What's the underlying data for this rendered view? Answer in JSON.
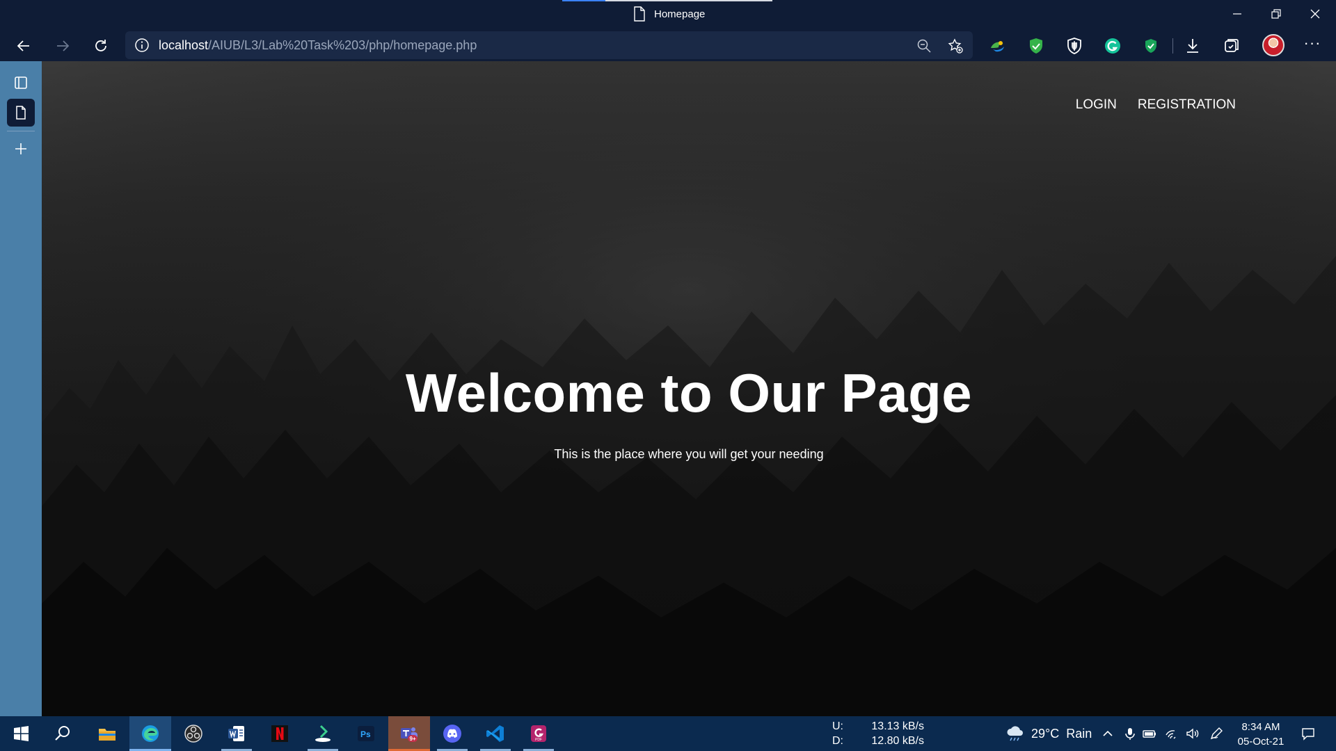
{
  "window": {
    "title": "Homepage"
  },
  "browser": {
    "url_host": "localhost",
    "url_path": "/AIUB/L3/Lab%20Task%203/php/homepage.php"
  },
  "site": {
    "nav": [
      "LOGIN",
      "REGISTRATION"
    ],
    "heading": "Welcome to Our Page",
    "subheading": "This is the place where you will get your needing"
  },
  "taskbar": {
    "apps": [
      {
        "name": "start-icon"
      },
      {
        "name": "search-icon"
      },
      {
        "name": "file-explorer-icon"
      },
      {
        "name": "edge-icon"
      },
      {
        "name": "obs-icon"
      },
      {
        "name": "word-icon"
      },
      {
        "name": "netflix-icon"
      },
      {
        "name": "downloader-icon"
      },
      {
        "name": "photoshop-icon"
      },
      {
        "name": "teams-icon",
        "badge": "9+"
      },
      {
        "name": "discord-icon"
      },
      {
        "name": "vscode-icon"
      },
      {
        "name": "pdf-app-icon"
      }
    ],
    "net_upload_label": "U:",
    "net_upload_value": "13.13 kB/s",
    "net_download_label": "D:",
    "net_download_value": "12.80 kB/s",
    "weather": "29°C  Rain",
    "time": "8:34 AM",
    "date": "05-Oct-21"
  },
  "colors": {
    "titlebar": "#0f1c36",
    "sidestrip": "#4a7fa8",
    "taskbar": "#0b2a4f",
    "accent": "#3b82f6"
  }
}
